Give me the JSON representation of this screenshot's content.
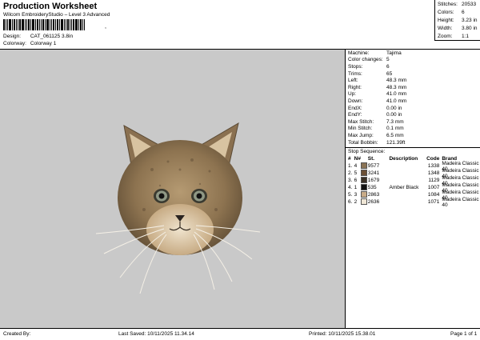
{
  "header": {
    "title": "Production Worksheet",
    "subtitle": "Wilcom EmbroideryStudio – Level 3 Advanced",
    "barcode_suffix": ","
  },
  "meta": {
    "design_label": "Design:",
    "design_value": "CAT_061125 3.8in",
    "colorway_label": "Colorway:",
    "colorway_value": "Colorway 1"
  },
  "stats": [
    {
      "label": "Stitches:",
      "value": "20533"
    },
    {
      "label": "Colors:",
      "value": "6"
    },
    {
      "label": "Height:",
      "value": "3.23 in"
    },
    {
      "label": "Width:",
      "value": "3.80 in"
    },
    {
      "label": "Zoom:",
      "value": "1:1"
    }
  ],
  "info": [
    {
      "label": "Machine:",
      "value": "Tajima"
    },
    {
      "label": "Color changes:",
      "value": "5"
    },
    {
      "label": "Stops:",
      "value": "6"
    },
    {
      "label": "Trims:",
      "value": "65"
    },
    {
      "label": "Left:",
      "value": "48.3 mm"
    },
    {
      "label": "Right:",
      "value": "48.3 mm"
    },
    {
      "label": "Up:",
      "value": "41.0 mm"
    },
    {
      "label": "Down:",
      "value": "41.0 mm"
    },
    {
      "label": "EndX:",
      "value": "0.00 in"
    },
    {
      "label": "EndY:",
      "value": "0.00 in"
    },
    {
      "label": "Max Stitch:",
      "value": "7.3 mm"
    },
    {
      "label": "Min Stitch:",
      "value": "0.1 mm"
    },
    {
      "label": "Max Jump:",
      "value": "6.5 mm"
    },
    {
      "label": "Total Bobbin:",
      "value": "121.39ft"
    }
  ],
  "stop_sequence": {
    "title": "Stop Sequence:",
    "headers": {
      "idx": "#",
      "n": "N#",
      "st": "St.",
      "desc": "Description",
      "code": "Code",
      "brand": "Brand"
    },
    "rows": [
      {
        "idx": "1.",
        "n": "4",
        "color": "#8a7355",
        "st": "9577",
        "desc": "",
        "code": "1338",
        "brand": "Madeira Classic 40"
      },
      {
        "idx": "2.",
        "n": "5",
        "color": "#6b4f35",
        "st": "3241",
        "desc": "",
        "code": "1348",
        "brand": "Madeira Classic 40"
      },
      {
        "idx": "3.",
        "n": "6",
        "color": "#3a3025",
        "st": "1679",
        "desc": "",
        "code": "1129",
        "brand": "Madeira Classic 40"
      },
      {
        "idx": "4.",
        "n": "1",
        "color": "#111111",
        "st": "535",
        "desc": "Amber Black",
        "code": "1007",
        "brand": "Madeira Classic 40"
      },
      {
        "idx": "5.",
        "n": "3",
        "color": "#c8ab88",
        "st": "2863",
        "desc": "",
        "code": "1084",
        "brand": "Madeira Classic 40"
      },
      {
        "idx": "6.",
        "n": "2",
        "color": "#efe6d6",
        "st": "2636",
        "desc": "",
        "code": "1071",
        "brand": "Madeira Classic 40"
      }
    ]
  },
  "footer": {
    "created_by": "Created By:",
    "last_saved": "Last Saved: 10/11/2025 11.34.14",
    "printed": "Printed: 10/11/2025 15.38.01",
    "page": "Page 1 of 1"
  }
}
